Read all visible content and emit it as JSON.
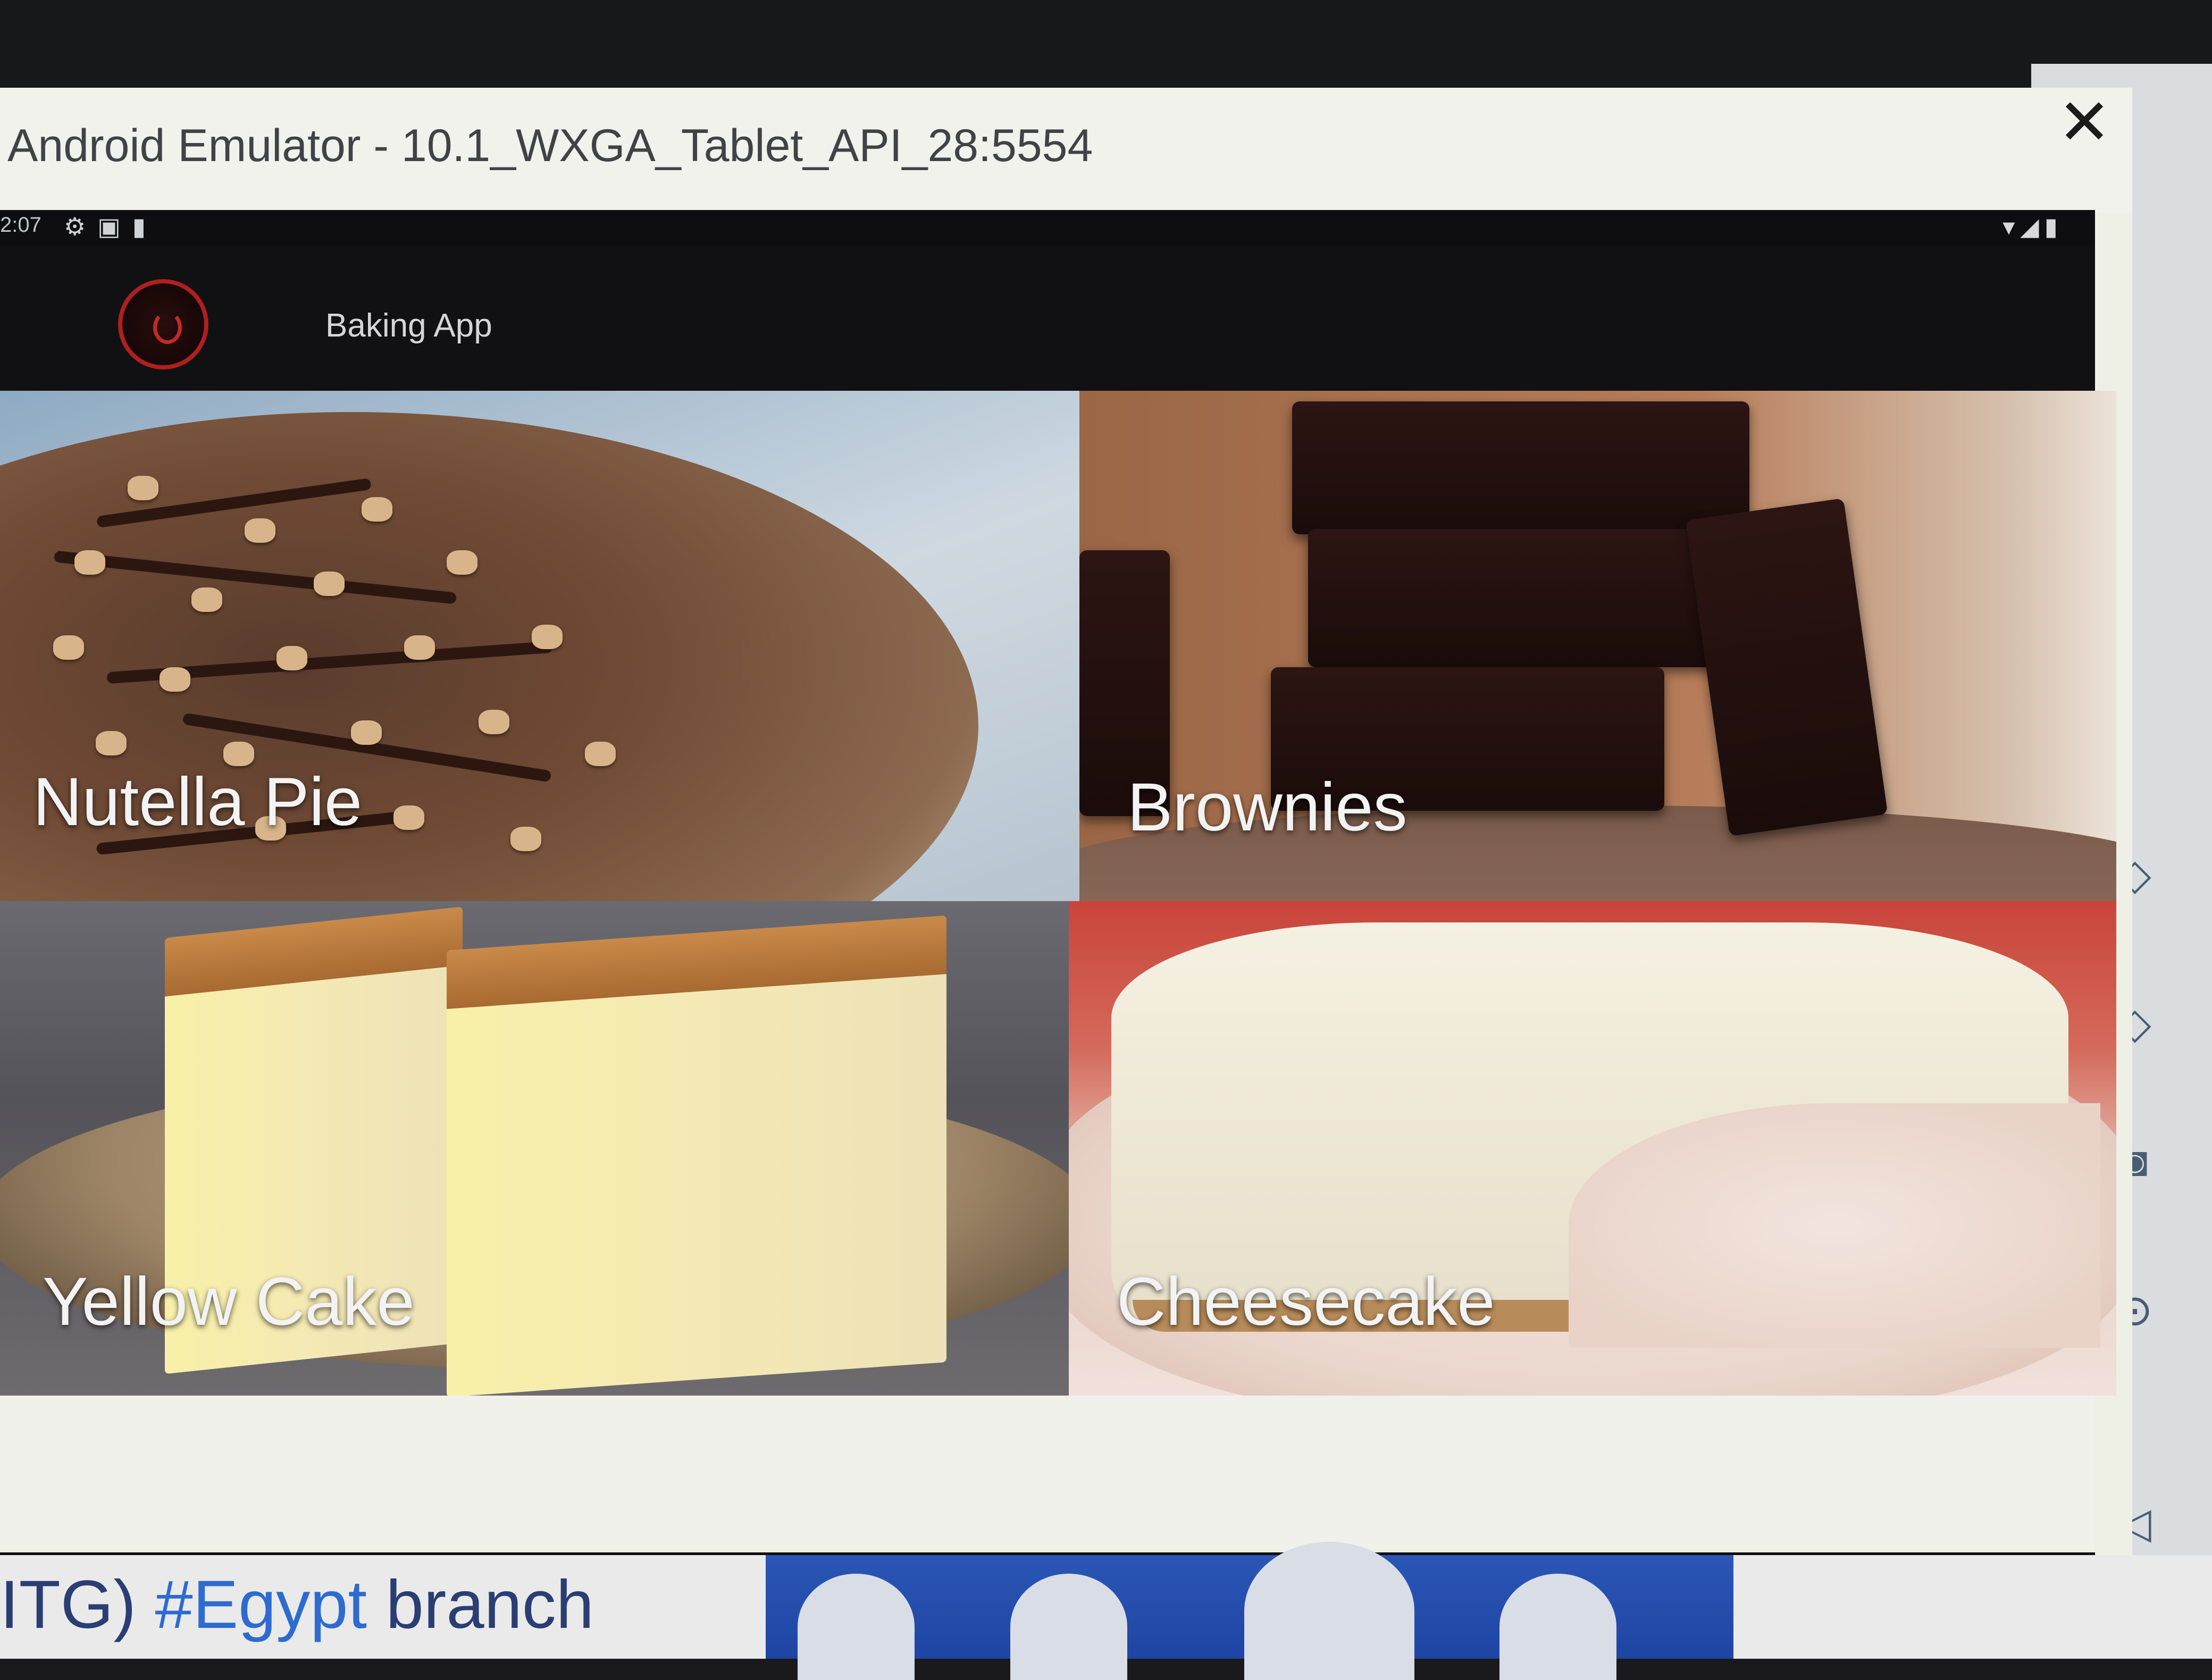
{
  "window": {
    "title": "Android Emulator - 10.1_WXGA_Tablet_API_28:5554",
    "close_symbol": "✕"
  },
  "status_bar": {
    "time": "2:07",
    "left_icons": [
      "gear-icon",
      "image-icon",
      "sd-card-icon"
    ],
    "right_icons": [
      "wifi-icon",
      "signal-icon",
      "battery-icon"
    ]
  },
  "app_bar": {
    "title": "Baking App",
    "logo": "power-icon"
  },
  "recipes": [
    {
      "name": "Nutella Pie"
    },
    {
      "name": "Brownies"
    },
    {
      "name": "Yellow Cake"
    },
    {
      "name": "Cheesecake"
    }
  ],
  "nav_bar": {
    "back": "◀",
    "home": "●",
    "recents": "■"
  },
  "background_text": {
    "prefix": "ITG) ",
    "hashtag": "#Egypt",
    "suffix": " branch"
  },
  "colors": {
    "app_bar": "#111013",
    "logo_accent": "#b01f1f",
    "hashtag": "#2d6bd0"
  }
}
